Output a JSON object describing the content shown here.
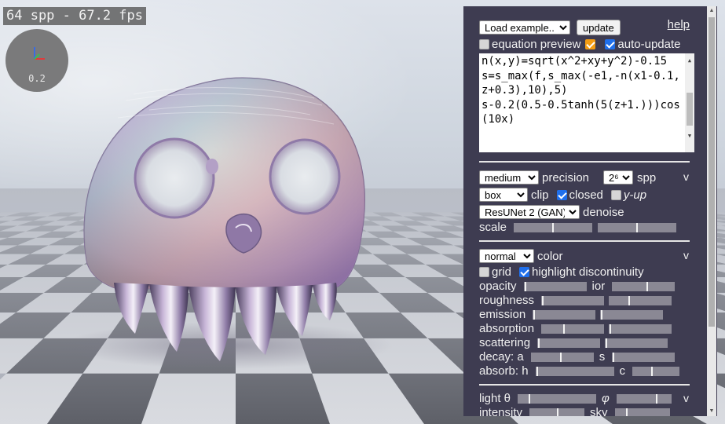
{
  "viewport": {
    "fps_text": "64 spp - 67.2 fps",
    "axis_scale": "0.2"
  },
  "panel": {
    "load_example": "Load example...",
    "update_label": "update",
    "help_label": "help",
    "equation_preview_label": "equation preview",
    "equation_preview_checked": false,
    "orange_checked": true,
    "auto_update_label": "auto-update",
    "auto_update_checked": true,
    "equation_lines": [
      "n(x,y)=sqrt(x^2+xy+y^2)-0.15",
      "s=s_max(f,s_max(-e1,-n(x1-0.1,z+0.3),10),5)",
      "s-0.2(0.5-0.5tanh(5(z+1.)))cos(10x)"
    ],
    "render": {
      "precision_value": "medium",
      "precision_label": "precision",
      "spp_value": "2⁶",
      "spp_label": "spp",
      "toggle": "v",
      "clip_value": "box",
      "clip_label": "clip",
      "closed_label": "closed",
      "closed_checked": true,
      "yup_label": "y-up",
      "yup_checked": false,
      "denoise_value": "ResUNet 2 (GAN)",
      "denoise_label": "denoise",
      "scale_label": "scale",
      "scale_knobs": [
        0.5,
        0.5
      ]
    },
    "color": {
      "mode_value": "normal",
      "color_label": "color",
      "toggle": "v",
      "grid_label": "grid",
      "grid_checked": false,
      "highlight_label": "highlight discontinuity",
      "highlight_checked": true,
      "opacity_label": "opacity",
      "ior_label": "ior",
      "roughness_label": "roughness",
      "emission_label": "emission",
      "absorption_label": "absorption",
      "scattering_label": "scattering",
      "decay_label": "decay: a",
      "decay_s_label": "s",
      "absorb_label": "absorb: h",
      "absorb_c_label": "c"
    },
    "light": {
      "theta_label": "light θ",
      "phi_label": "φ",
      "toggle": "v",
      "intensity_label": "intensity",
      "sky_label": "sky"
    }
  }
}
